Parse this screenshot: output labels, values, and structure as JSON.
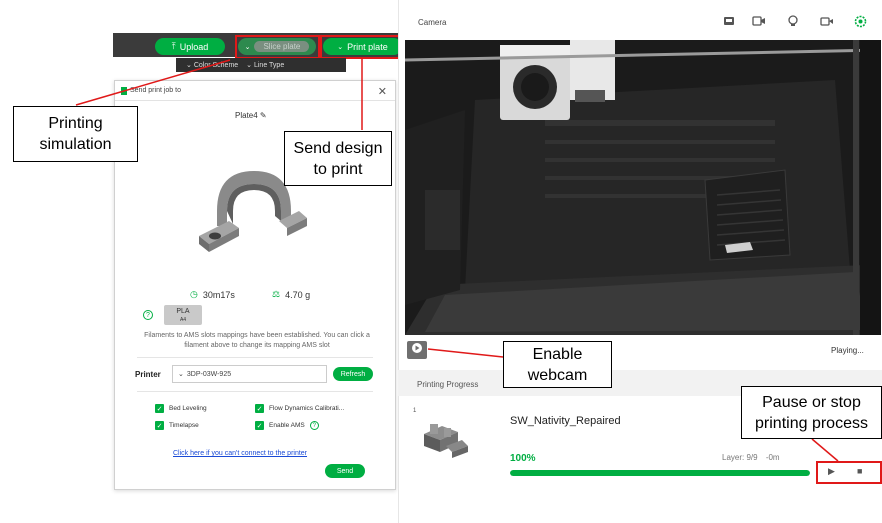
{
  "slicer": {
    "toolbar": {
      "upload_label": "Upload",
      "slice_label": "Slice plate",
      "print_label": "Print plate",
      "color_scheme_label": "Color Scheme",
      "line_type_label": "Line Type"
    },
    "dialog": {
      "title": "Send print job to",
      "plate_name": "Plate4",
      "print_time": "30m17s",
      "weight": "4.70 g",
      "filament": {
        "type": "PLA",
        "slot": "A4"
      },
      "mapping_note": "Filaments to AMS slots mappings have been established. You can click a filament above to change its mapping AMS slot",
      "printer_label": "Printer",
      "printer_value": "3DP-03W-925",
      "refresh_label": "Refresh",
      "options": [
        {
          "label": "Bed Leveling"
        },
        {
          "label": "Flow Dynamics Calibrati..."
        },
        {
          "label": "Timelapse"
        },
        {
          "label": "Enable AMS"
        }
      ],
      "connect_link": "Click here if you can't connect to the printer",
      "send_label": "Send"
    }
  },
  "monitor": {
    "camera_title": "Camera",
    "playing_status": "Playing...",
    "progress_title": "Printing Progress",
    "plate_number": "1",
    "job_name": "SW_Nativity_Repaired",
    "progress_text": "100%",
    "progress_value": 1.0,
    "layer_info": "Layer: 9/9",
    "time_left": "-0m"
  },
  "annotations": {
    "printing_simulation": "Printing\nsimulation",
    "send_design": "Send design\nto print",
    "enable_webcam": "Enable\nwebcam",
    "pause_stop": "Pause or stop\nprinting process"
  },
  "colors": {
    "accent_green": "#00ae42",
    "highlight_red": "#e01919"
  }
}
